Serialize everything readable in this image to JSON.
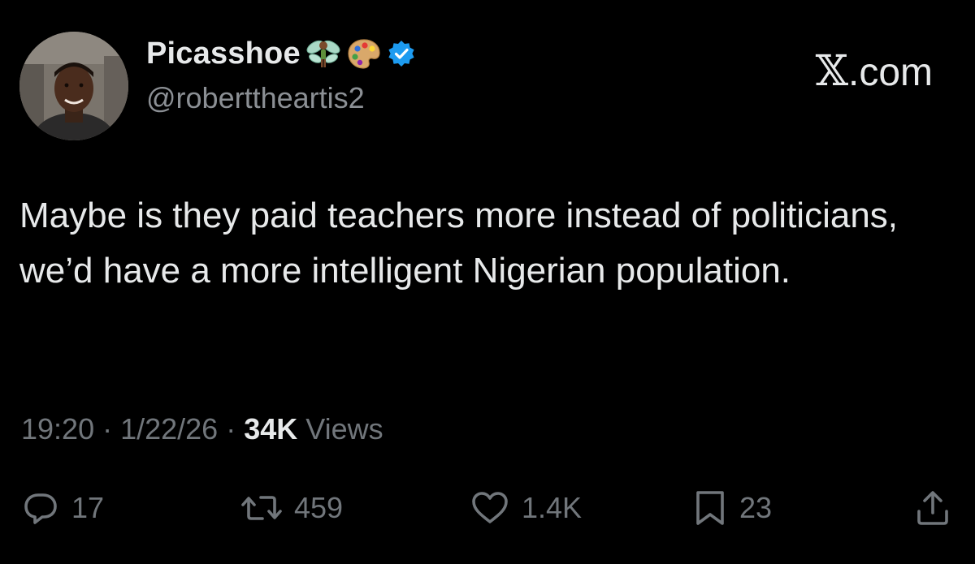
{
  "author": {
    "display_name": "Picasshoe",
    "handle": "@roberttheartis2",
    "verified": true,
    "verified_color": "#1d9bf0",
    "name_emojis": [
      "fairy-emoji",
      "artist-palette-emoji"
    ]
  },
  "brand": {
    "mark": "𝕏",
    "suffix": ".com"
  },
  "tweet": {
    "text": "Maybe is they paid teachers more instead of politicians, we’d have a more intelligent Nigerian population."
  },
  "meta": {
    "time": "19:20",
    "sep1": " · ",
    "date": "1/22/26",
    "sep2": " · ",
    "views_count": "34K",
    "views_label": " Views"
  },
  "actions": {
    "replies": "17",
    "reposts": "459",
    "likes": "1.4K",
    "bookmarks": "23",
    "icons": [
      "reply-icon",
      "repost-icon",
      "like-icon",
      "bookmark-icon",
      "share-icon"
    ]
  },
  "colors": {
    "background": "#000000",
    "primary_text": "#e7e9ea",
    "secondary_text": "#71767b"
  }
}
